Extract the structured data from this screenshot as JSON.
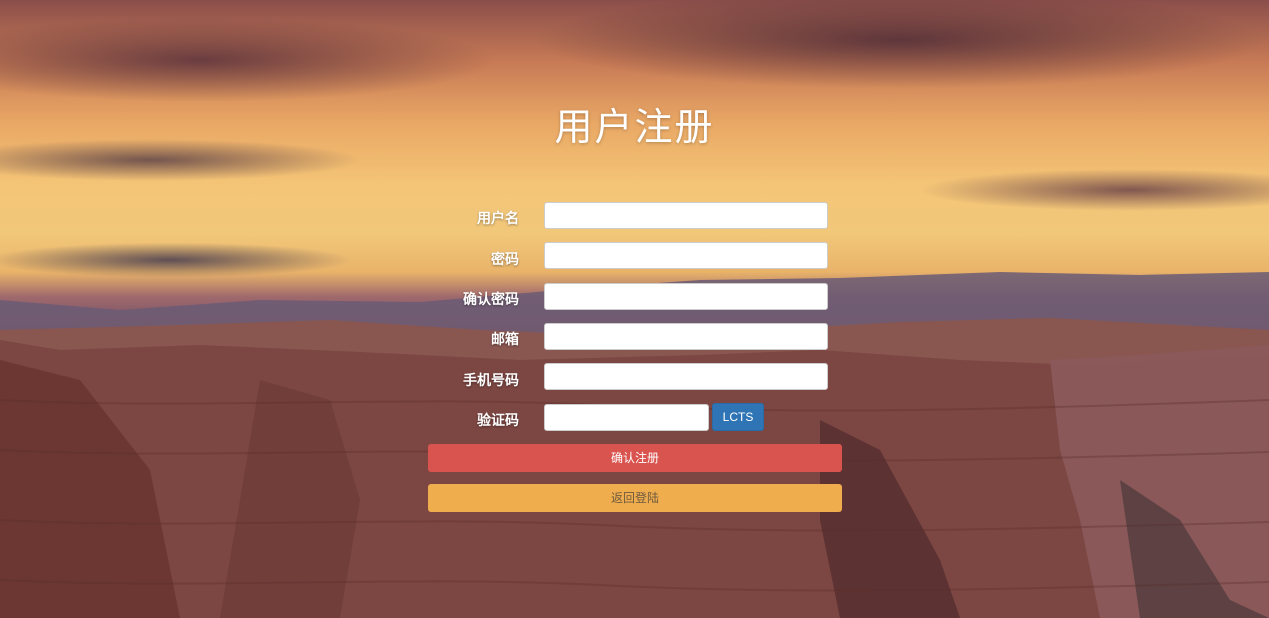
{
  "page": {
    "title": "用户注册",
    "background": "canyon-sunset-landscape"
  },
  "form": {
    "fields": [
      {
        "label": "用户名",
        "value": "",
        "type": "text"
      },
      {
        "label": "密码",
        "value": "",
        "type": "password"
      },
      {
        "label": "确认密码",
        "value": "",
        "type": "password"
      },
      {
        "label": "邮箱",
        "value": "",
        "type": "text"
      },
      {
        "label": "手机号码",
        "value": "",
        "type": "text"
      },
      {
        "label": "验证码",
        "value": "",
        "type": "text"
      }
    ],
    "captcha_button": "LCTS",
    "submit_button": "确认注册",
    "back_button": "返回登陆"
  },
  "colors": {
    "submit": "#d9534f",
    "back": "#f0ad4e",
    "captcha": "#2f75b5"
  }
}
